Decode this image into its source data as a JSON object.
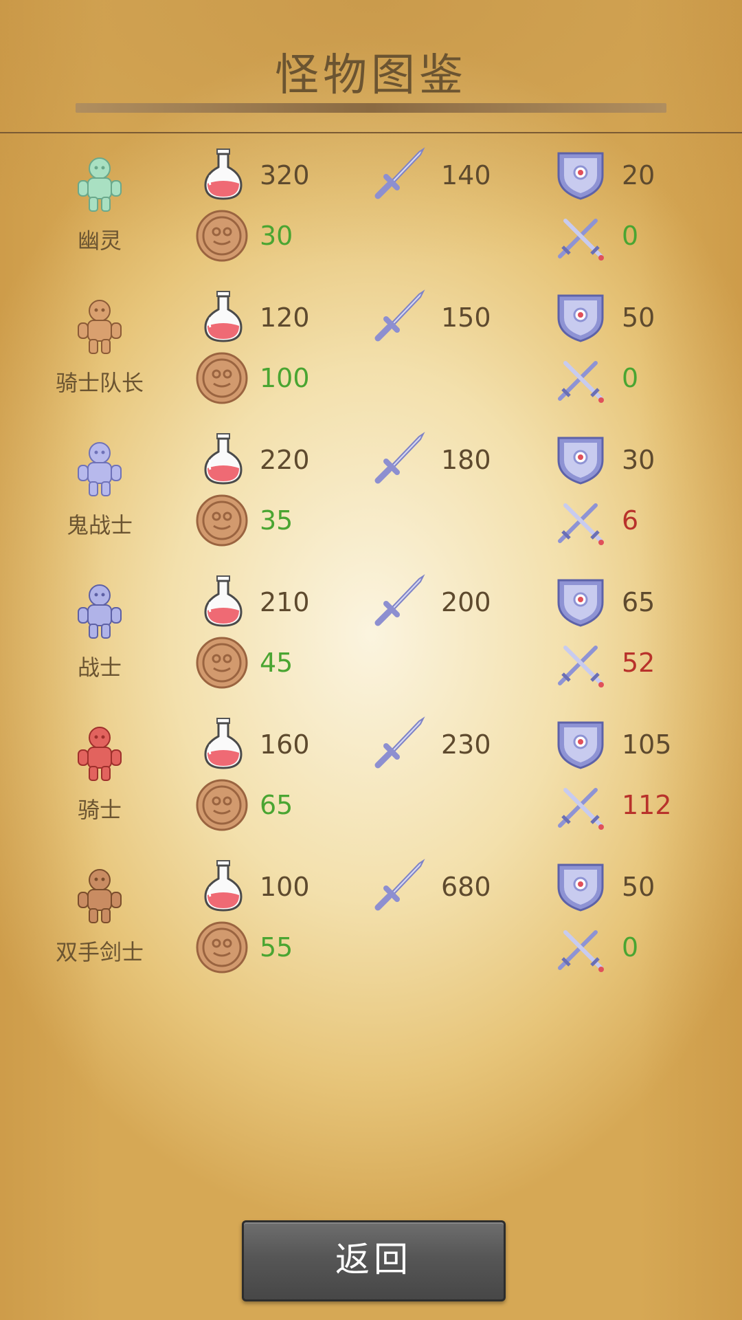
{
  "title": "怪物图鉴",
  "back_label": "返回",
  "colors": {
    "text": "#5e4a2e",
    "positive": "#4aa532",
    "negative": "#b8322b"
  },
  "icons": {
    "hp": "potion-icon",
    "atk": "sword-icon",
    "def": "shield-icon",
    "gold": "coin-icon",
    "dmg": "crossed-swords-icon"
  },
  "monsters": [
    {
      "name": "幽灵",
      "sprite": "ghost-sprite",
      "hp": "320",
      "atk": "140",
      "def": "20",
      "gold": "30",
      "damage": "0"
    },
    {
      "name": "骑士队长",
      "sprite": "knight-captain-sprite",
      "hp": "120",
      "atk": "150",
      "def": "50",
      "gold": "100",
      "damage": "0"
    },
    {
      "name": "鬼战士",
      "sprite": "ghost-warrior-sprite",
      "hp": "220",
      "atk": "180",
      "def": "30",
      "gold": "35",
      "damage": "6"
    },
    {
      "name": "战士",
      "sprite": "warrior-sprite",
      "hp": "210",
      "atk": "200",
      "def": "65",
      "gold": "45",
      "damage": "52"
    },
    {
      "name": "骑士",
      "sprite": "knight-sprite",
      "hp": "160",
      "atk": "230",
      "def": "105",
      "gold": "65",
      "damage": "112"
    },
    {
      "name": "双手剑士",
      "sprite": "swordsman-sprite",
      "hp": "100",
      "atk": "680",
      "def": "50",
      "gold": "55",
      "damage": "0"
    }
  ]
}
